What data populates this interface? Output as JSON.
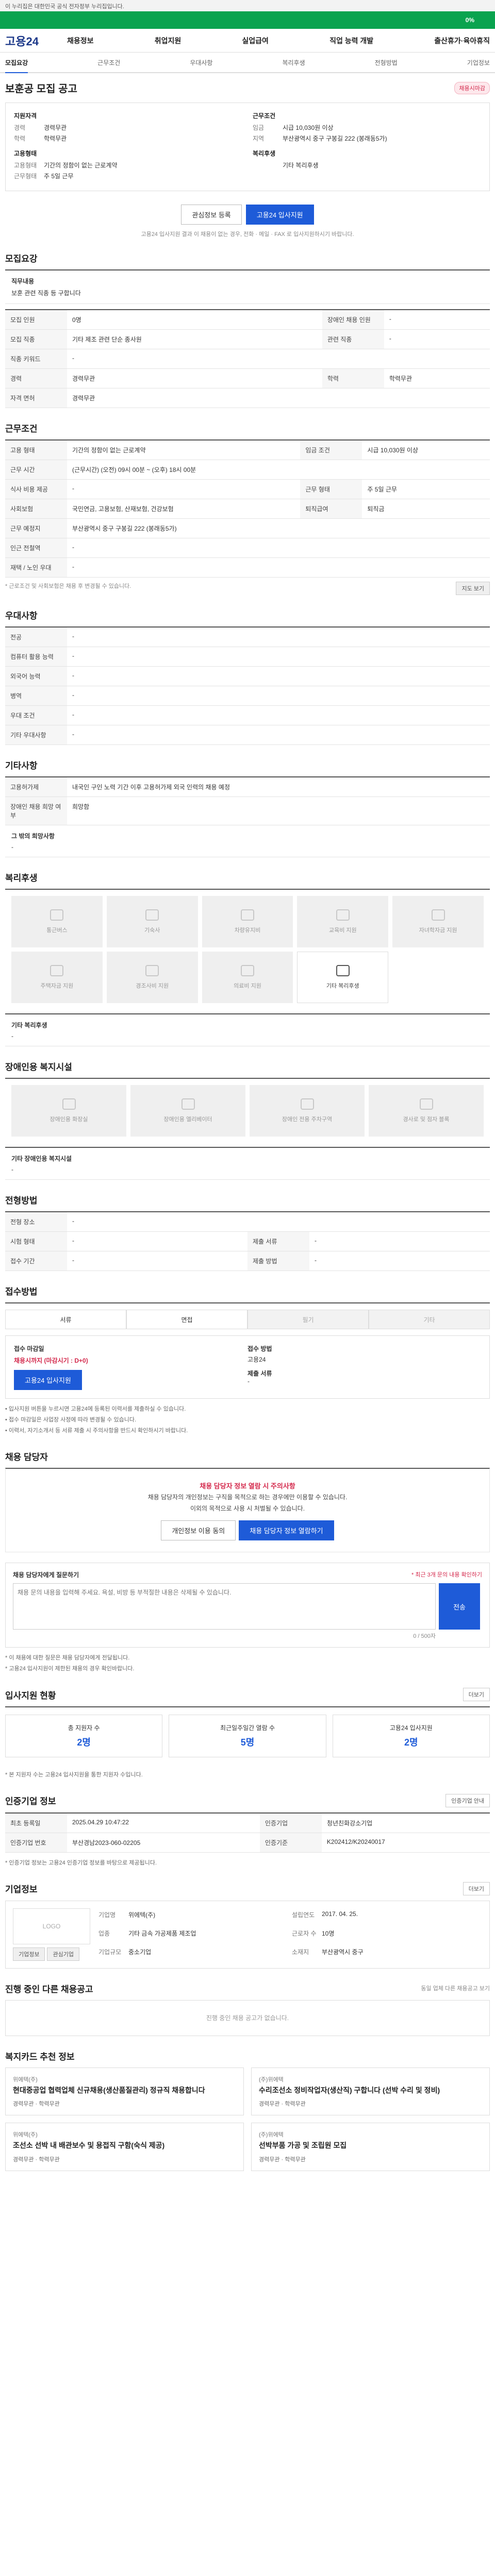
{
  "gov_bar": "이 누리집은 대한민국 공식 전자정부 누리집입니다.",
  "header": {
    "logo": "고용24",
    "menu": [
      "채용정보",
      "취업지원",
      "실업급여",
      "직업 능력 개발",
      "출산휴가·육아휴직"
    ],
    "progress_label": "0%",
    "progress_value": 0
  },
  "subtabs": [
    "모집요강",
    "근무조건",
    "우대사항",
    "복리후생",
    "전형방법",
    "기업정보"
  ],
  "posting": {
    "title": "보훈공 모집 공고",
    "status": "채용시마감",
    "left_group_title": "지원자격",
    "left_pairs": [
      {
        "k": "경력",
        "v": "경력무관"
      },
      {
        "k": "학력",
        "v": "학력무관"
      }
    ],
    "left_group2_title": "고용형태",
    "left_pairs2": [
      {
        "k": "고용형태",
        "v": "기간의 정함이 없는 근로계약"
      },
      {
        "k": "근무형태",
        "v": "주 5일 근무"
      }
    ],
    "right_group_title": "근무조건",
    "right_pairs": [
      {
        "k": "임금",
        "v": "시급 10,030원 이상"
      },
      {
        "k": "지역",
        "v": "부산광역시 중구 구봉길 222 (봉래동5가)"
      }
    ],
    "right_group2_title": "복리후생",
    "right_pairs2": [
      {
        "k": "",
        "v": "기타 복리후생"
      }
    ],
    "btn_scrap": "관심정보 등록",
    "btn_apply": "고용24 입사지원",
    "apply_note": "고용24 입사지원 결과 이 채용이 없는 경우, 전화 · 메일 · FAX 로 입사지원하시기 바랍니다."
  },
  "sections": {
    "recruit": "모집요강",
    "conditions": "근무조건",
    "preference": "우대사항",
    "other": "기타사항",
    "welfare": "복리후생",
    "disabled": "장애인용 복지시설",
    "screening": "전형방법",
    "method": "접수방법",
    "contact": "채용 담당자",
    "applicants": "입사지원 현황",
    "cert": "인증기업 정보",
    "company": "기업정보",
    "other_jobs": "진행 중인 다른 채용공고",
    "recommend": "복지카드 추천 정보"
  },
  "recruit_box": {
    "title": "직무내용",
    "text": "보훈 관련 직종 등 구합니다"
  },
  "recruit_table": [
    [
      "모집 인원",
      "0명",
      "장애인 채용 인원",
      "-"
    ],
    [
      "모집 직종",
      "기타 제조 관련 단순 종사원",
      "관련 직종",
      "-"
    ],
    [
      "직종 키워드",
      "-",
      "",
      ""
    ],
    [
      "경력",
      "경력무관",
      "학력",
      "학력무관"
    ],
    [
      "자격 면허",
      "경력무관",
      "",
      ""
    ]
  ],
  "cond_table": [
    [
      "고용 형태",
      "기간의 정함이 없는 근로계약",
      "임금 조건",
      "시급 10,030원 이상"
    ],
    [
      "근무 시간",
      "(근무시간) (오전) 09시 00분 ~ (오후) 18시 00분",
      "",
      ""
    ],
    [
      "식사 비용 제공",
      "-",
      "근무 형태",
      "주 5일 근무"
    ],
    [
      "사회보험",
      "국민연금, 고용보험, 산재보험, 건강보험",
      "퇴직급여",
      "퇴직금"
    ],
    [
      "근무 예정지",
      "부산광역시 중구 구봉길 222 (봉래동5가)",
      "",
      ""
    ],
    [
      "인근 전철역",
      "-",
      "",
      ""
    ],
    [
      "재택 / 노인 우대",
      "-",
      "",
      ""
    ]
  ],
  "cond_note": "* 근로조건 및 사회보험은 채용 후 변경될 수 있습니다.",
  "map_btn": "지도 보기",
  "pref_table": [
    [
      "전공",
      "-"
    ],
    [
      "컴퓨터 활용 능력",
      "-"
    ],
    [
      "외국어 능력",
      "-"
    ],
    [
      "병역",
      "-"
    ],
    [
      "우대 조건",
      "-"
    ],
    [
      "기타 우대사항",
      "-"
    ]
  ],
  "other_table": [
    [
      "고용허가제",
      "내국인 구인 노력 기간 이후 고용허가제 외국 인력의 채용 예정"
    ],
    [
      "장애인 채용 희망 여부",
      "희망함"
    ]
  ],
  "other_box": {
    "title": "그 밖의 희망사항",
    "text": "-"
  },
  "welfare_tiles": [
    {
      "label": "통근버스",
      "on": false
    },
    {
      "label": "기숙사",
      "on": false
    },
    {
      "label": "차량유지비",
      "on": false
    },
    {
      "label": "교육비 지원",
      "on": false
    },
    {
      "label": "자녀학자금 지원",
      "on": false
    },
    {
      "label": "주택자금 지원",
      "on": false
    },
    {
      "label": "경조사비 지원",
      "on": false
    },
    {
      "label": "의료비 지원",
      "on": false
    },
    {
      "label": "기타 복리후생",
      "on": true
    }
  ],
  "welfare_box": {
    "title": "기타 복리후생",
    "text": "-"
  },
  "disabled_tiles": [
    "장애인용 화장실",
    "장애인용 엘리베이터",
    "장애인 전용 주차구역",
    "경사로 및 점자 블록"
  ],
  "disabled_box": {
    "title": "기타 장애인용 복지시설",
    "text": "-"
  },
  "screening_table": [
    [
      "전형 장소",
      "-",
      "",
      ""
    ],
    [
      "시험 형태",
      "-",
      "제출 서류",
      "-"
    ],
    [
      "접수 기간",
      "-",
      "제출 방법",
      "-"
    ]
  ],
  "method_tiles": [
    {
      "label": "서류",
      "on": true
    },
    {
      "label": "면접",
      "on": true
    },
    {
      "label": "필기",
      "on": false
    },
    {
      "label": "기타",
      "on": false
    }
  ],
  "receipt": {
    "l1": "접수 마감일",
    "l1v": "채용시까지 (마감시기 : D+0)",
    "btn": "고용24 입사지원",
    "r1": "접수 방법",
    "r1v": "고용24",
    "r2": "제출 서류",
    "r2v": "-"
  },
  "receipt_bullets": [
    "• 입사지원 버튼을 누르시면 고용24에 등록된 이력서를 제출하실 수 있습니다.",
    "• 접수 마감일은 사업장 사정에 따라 변경될 수 있습니다.",
    "• 이력서, 자기소개서 등 서류 제출 시 주의사항을 반드시 확인하시기 바랍니다."
  ],
  "contact_warn": {
    "t": "채용 담당자 정보 열람 시 주의사항",
    "line1": "채용 담당자의 개인정보는 구직을 목적으로 하는 경우에만 이용할 수 있습니다.",
    "line2": "이외의 목적으로 사용 시 처벌될 수 있습니다.",
    "b1": "개인정보 이용 동의",
    "b2": "채용 담당자 정보 열람하기"
  },
  "qbox": {
    "title": "채용 담당자에게 질문하기",
    "hint": "* 최근 3개 문의 내용 확인하기",
    "placeholder": "채용 문의 내용을 입력해 주세요. 욕설, 비방 등 부적절한 내용은 삭제될 수 있습니다.",
    "count": "0 / 500자",
    "send": "전송"
  },
  "q_notes": [
    "* 이 채용에 대한 질문은 채용 담당자에게 전달됩니다.",
    "* 고용24 입사지원이 제한된 채용의 경우 확인바랍니다."
  ],
  "applicants_more": "더보기",
  "stats": [
    {
      "label": "총 지원자 수",
      "val": "2명"
    },
    {
      "label": "최근일주일간 열람 수",
      "val": "5명"
    },
    {
      "label": "고용24 입사지원",
      "val": "2명"
    }
  ],
  "stats_note": "* 본 지원자 수는 고용24 입사지원을 통한 지원자 수입니다.",
  "cert_btn": "인증기업 안내",
  "cert_table": [
    [
      "최초 등록일",
      "2025.04.29 10:47:22",
      "인증기업",
      "청년친화강소기업"
    ],
    [
      "인증기업 번호",
      "부산경남2023-060-02205",
      "인증기준",
      "K202412/K20240017"
    ]
  ],
  "cert_note": "* 인증기업 정보는 고용24 인증기업 정보를 바탕으로 제공됩니다.",
  "company_more": "더보기",
  "company": {
    "logo": "LOGO",
    "btn1": "기업정보",
    "btn2": "관심기업",
    "info": [
      {
        "k": "기업명",
        "v": "위에텍(주)"
      },
      {
        "k": "설립연도",
        "v": "2017. 04. 25."
      },
      {
        "k": "업종",
        "v": "기타 금속 가공제품 제조업"
      },
      {
        "k": "근로자 수",
        "v": "10명"
      },
      {
        "k": "기업규모",
        "v": "중소기업"
      },
      {
        "k": "소재지",
        "v": "부산광역시 중구"
      }
    ]
  },
  "other_jobs_empty": "진행 중인 채용 공고가 없습니다.",
  "other_jobs_note": "동일 업체 다른 채용공고 보기",
  "recommend_cards": [
    {
      "co": "위에텍(주)",
      "title": "현대중공업 협력업체 신규채용(생산품질관리) 정규직 채용합니다",
      "meta": "경력무관 · 학력무관"
    },
    {
      "co": "(주)위에텍",
      "title": "수리조선소 정비작업자(생산직) 구합니다 (선박 수리 및 정비)",
      "meta": "경력무관 · 학력무관"
    },
    {
      "co": "위에텍(주)",
      "title": "조선소 선박 내 배관보수 및 용접직 구함(숙식 제공)",
      "meta": "경력무관 · 학력무관"
    },
    {
      "co": "(주)위에텍",
      "title": "선박부품 가공 및 조립원 모집",
      "meta": "경력무관 · 학력무관"
    }
  ]
}
